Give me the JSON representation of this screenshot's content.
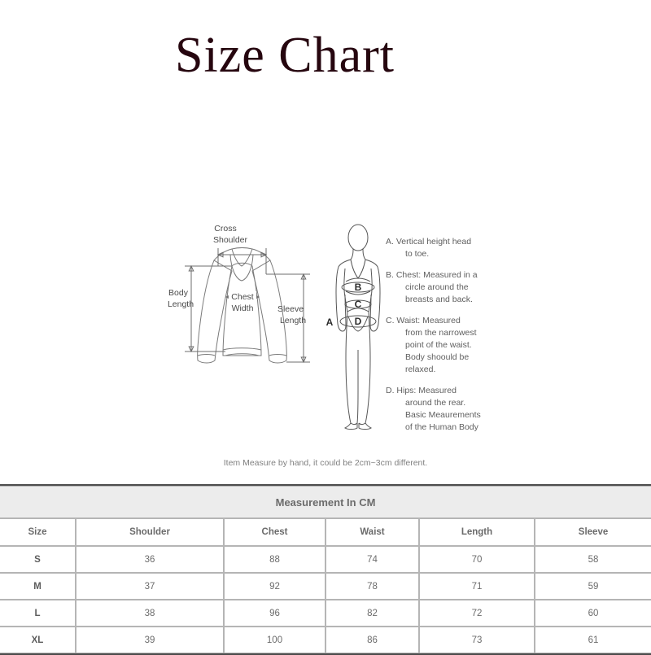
{
  "page": {
    "title": "Size Chart",
    "note": "Item Measure by hand, it could be 2cm~3cm different."
  },
  "garment_diagram": {
    "labels": {
      "cross_shoulder_line1": "Cross",
      "cross_shoulder_line2": "Shoulder",
      "body_length_line1": "Body",
      "body_length_line2": "Length",
      "chest_width_line1": "Chest",
      "chest_width_line2": "Width",
      "sleeve_length_line1": "Sleeve",
      "sleeve_length_line2": "Length"
    }
  },
  "body_diagram": {
    "markers": {
      "a": "A",
      "b": "B",
      "c": "C",
      "d": "D"
    }
  },
  "legend": {
    "entries": [
      {
        "lines": [
          "A. Vertical height head",
          "to toe."
        ]
      },
      {
        "lines": [
          "B. Chest: Measured in a",
          "circle around the",
          "breasts and back."
        ]
      },
      {
        "lines": [
          "C. Waist: Measured",
          "from the narrowest",
          "point of the waist.",
          "Body shoould be",
          "relaxed."
        ]
      },
      {
        "lines": [
          "D. Hips: Measured",
          "around the rear.",
          "Basic Meaurements",
          "of the Human Body"
        ]
      }
    ]
  },
  "table": {
    "header": "Measurement In CM",
    "columns": [
      "Size",
      "Shoulder",
      "Chest",
      "Waist",
      "Length",
      "Sleeve"
    ],
    "rows": [
      [
        "S",
        "36",
        "88",
        "74",
        "70",
        "58"
      ],
      [
        "M",
        "37",
        "92",
        "78",
        "71",
        "59"
      ],
      [
        "L",
        "38",
        "96",
        "82",
        "72",
        "60"
      ],
      [
        "XL",
        "39",
        "100",
        "86",
        "73",
        "61"
      ]
    ]
  },
  "colors": {
    "title": "#26060f",
    "header_bg": "#ececec",
    "text_gray": "#6b6b6b",
    "line": "#7a7a7a"
  }
}
